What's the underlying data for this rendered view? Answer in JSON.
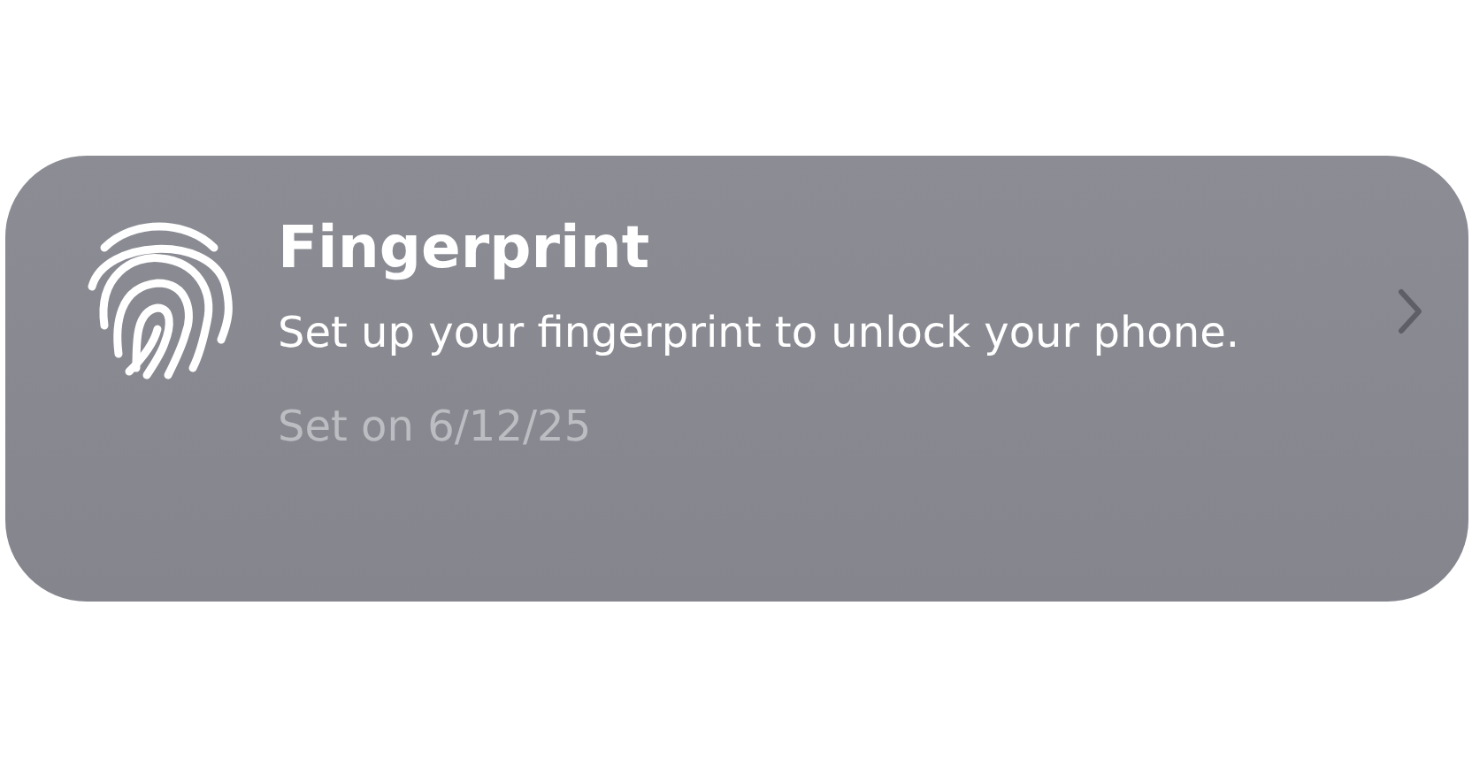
{
  "card": {
    "title": "Fingerprint",
    "description": "Set up your fingerprint to unlock your phone.",
    "status": "Set on 6/12/25"
  }
}
